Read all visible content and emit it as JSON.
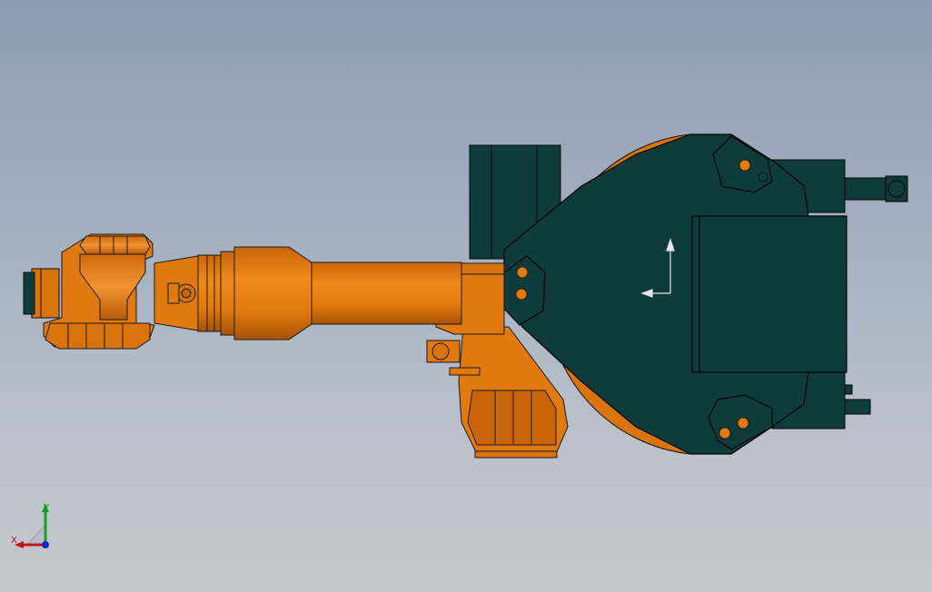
{
  "viewport": {
    "background_top": "#8e9db4",
    "background_bottom": "#c4c7cc"
  },
  "model": {
    "part_color_orange": "#e0780c",
    "part_color_orange_shadow": "#b55a06",
    "part_color_dark": "#0f3b3b",
    "edge_color": "#1a1a1a"
  },
  "triad": {
    "x_label": "X",
    "y_label": "Y",
    "x_color": "#c0141c",
    "y_color": "#14a028",
    "z_color": "#1428c8"
  }
}
